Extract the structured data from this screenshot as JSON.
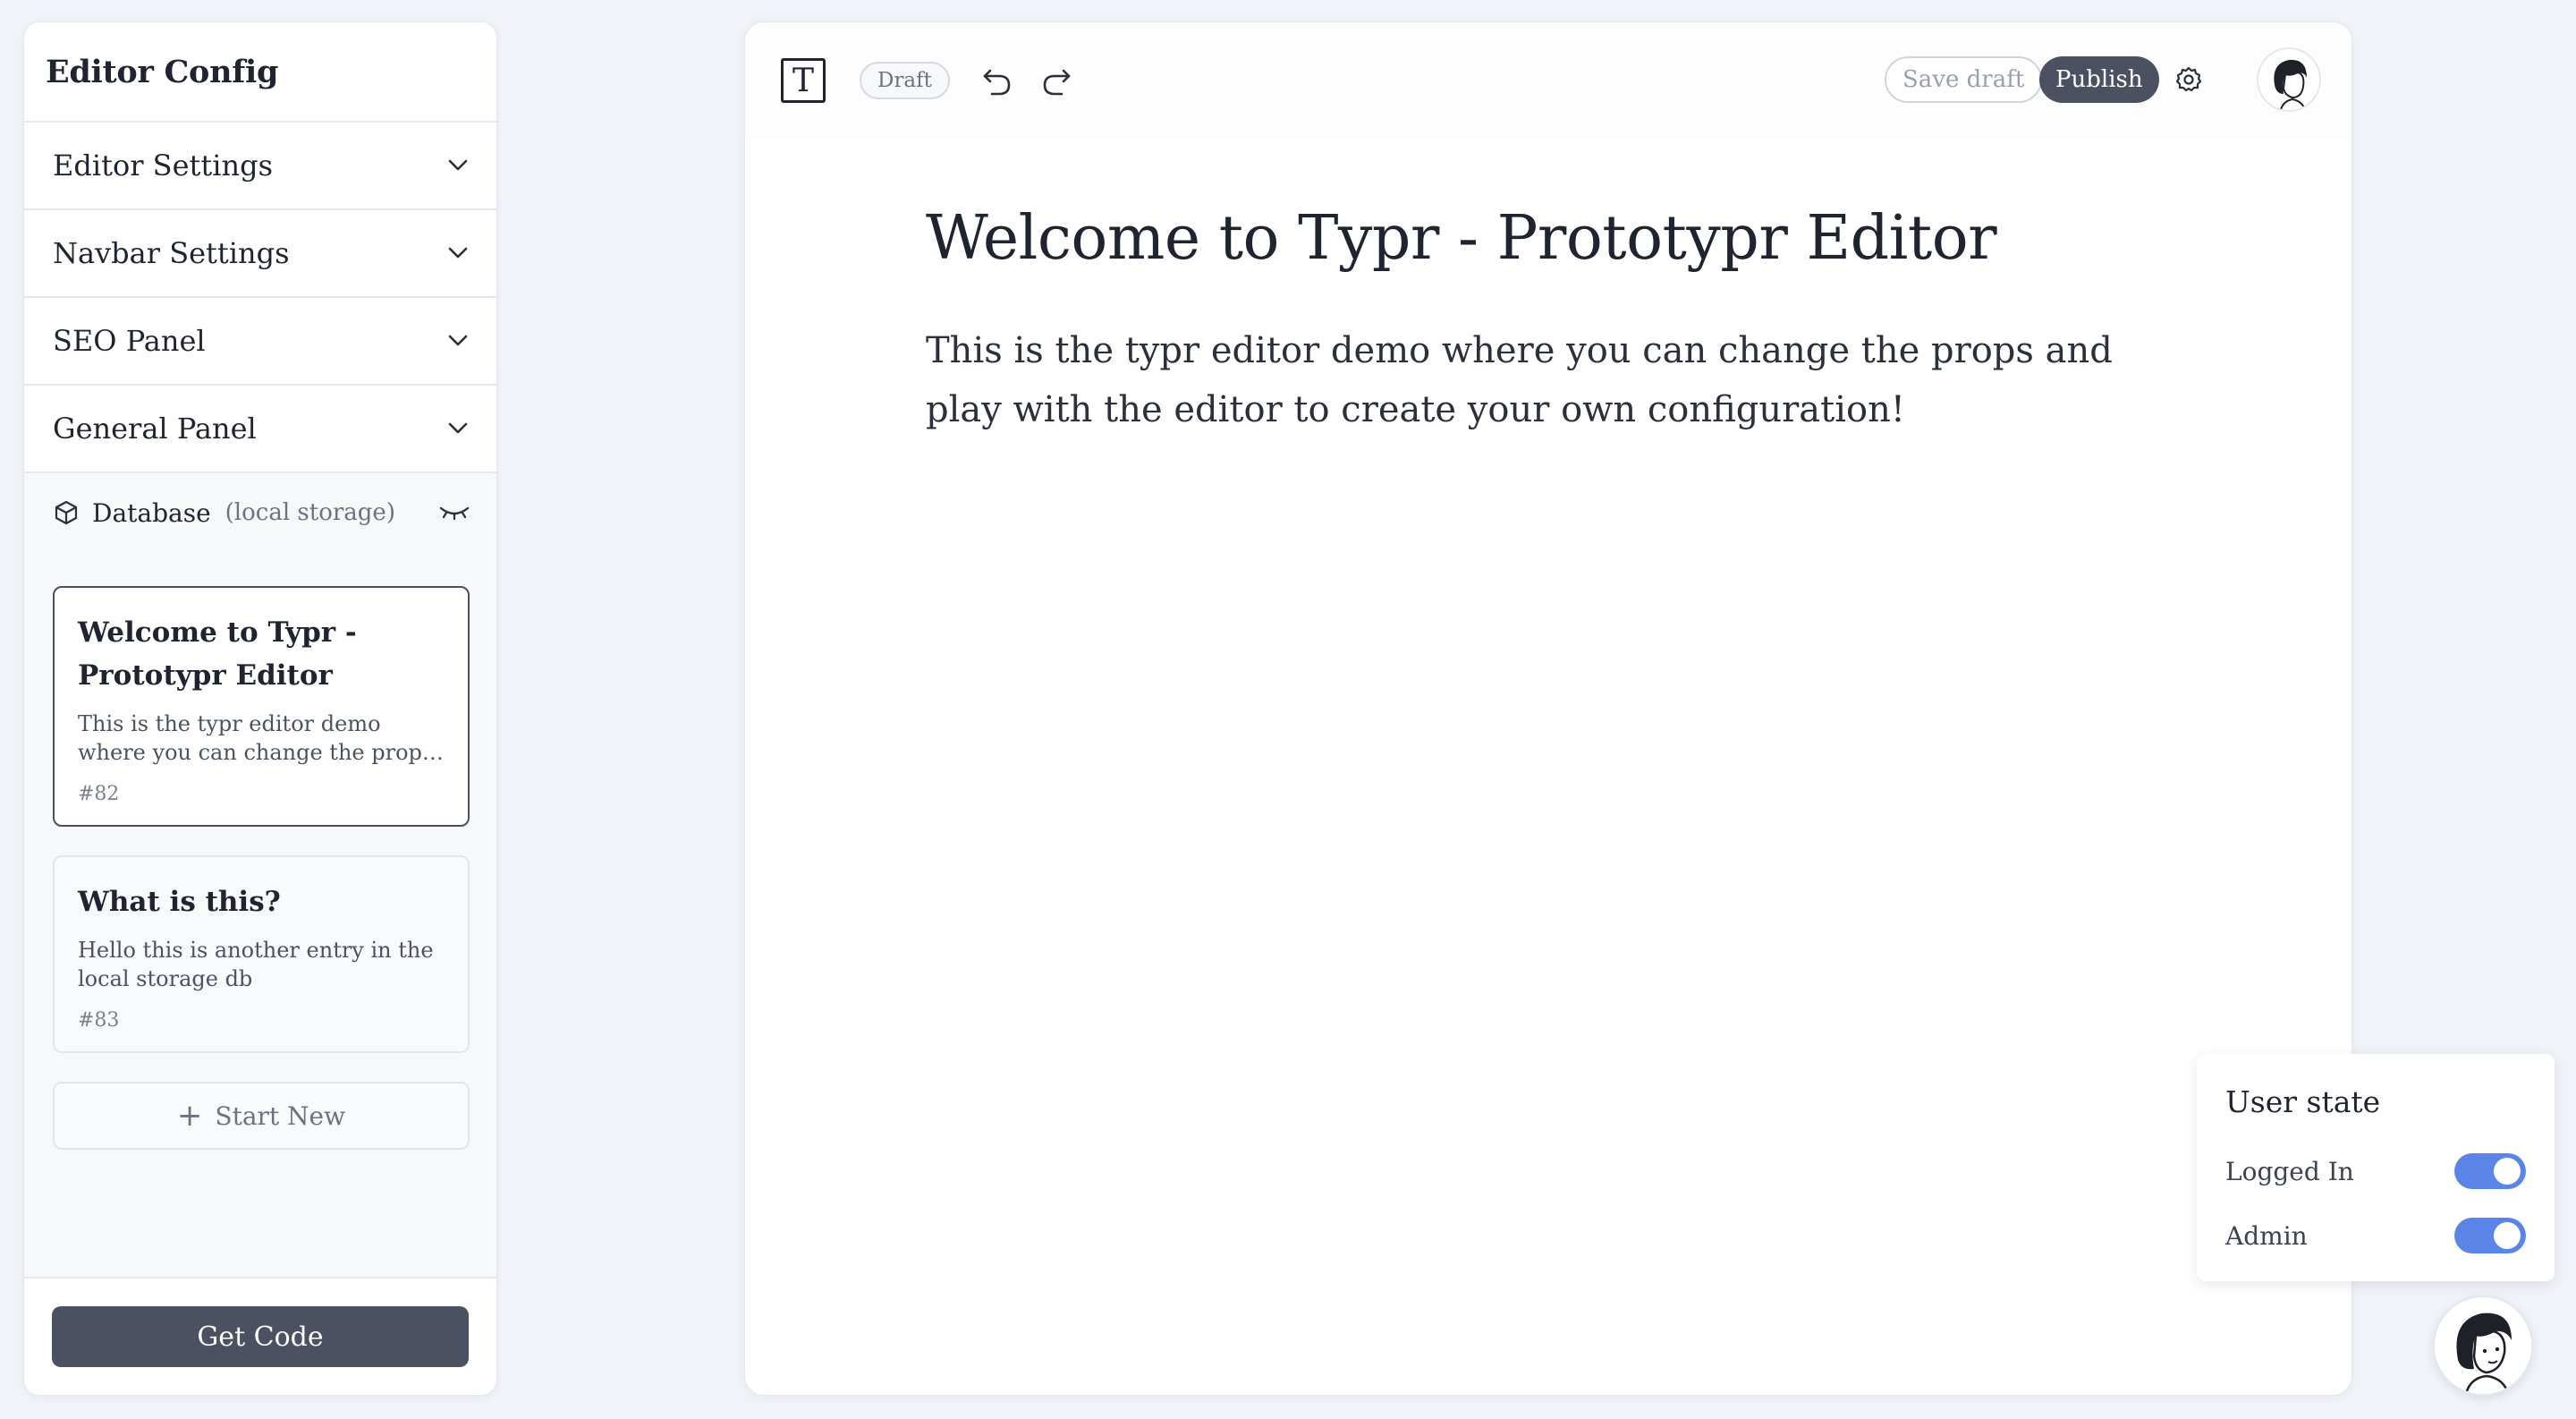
{
  "sidebar": {
    "title": "Editor Config",
    "accordion": [
      {
        "label": "Editor Settings"
      },
      {
        "label": "Navbar Settings"
      },
      {
        "label": "SEO Panel"
      },
      {
        "label": "General Panel"
      }
    ],
    "database": {
      "label": "Database",
      "sublabel": "(local storage)"
    },
    "entries": [
      {
        "title": "Welcome to Typr - Prototypr Editor",
        "excerpt": "This is the typr editor demo where you can change the props and play with the editor to create your own configuration!",
        "id": "#82"
      },
      {
        "title": "What is this?",
        "excerpt": "Hello this is another entry in the local storage db",
        "id": "#83"
      }
    ],
    "start_new_label": "Start New",
    "get_code_label": "Get Code"
  },
  "toolbar": {
    "logo_letter": "T",
    "status_badge": "Draft",
    "save_draft_label": "Save draft",
    "publish_label": "Publish"
  },
  "document": {
    "title": "Welcome to Typr - Prototypr Editor",
    "body": "This is the typr editor demo where you can change the props and play with the editor to create your own configuration!"
  },
  "user_state": {
    "title": "User state",
    "toggles": [
      {
        "label": "Logged In",
        "on": true
      },
      {
        "label": "Admin",
        "on": true
      }
    ]
  },
  "colors": {
    "accent_toggle": "#5b84e8",
    "dark_button": "#4b5161",
    "background": "#f0f3f8"
  },
  "icons": {
    "accordion": "chevron-down-icon",
    "database": "cube-icon",
    "database_toggle": "eye-closed-icon",
    "undo": "undo-icon",
    "redo": "redo-icon",
    "settings": "gear-icon",
    "start_new": "plus-icon"
  }
}
